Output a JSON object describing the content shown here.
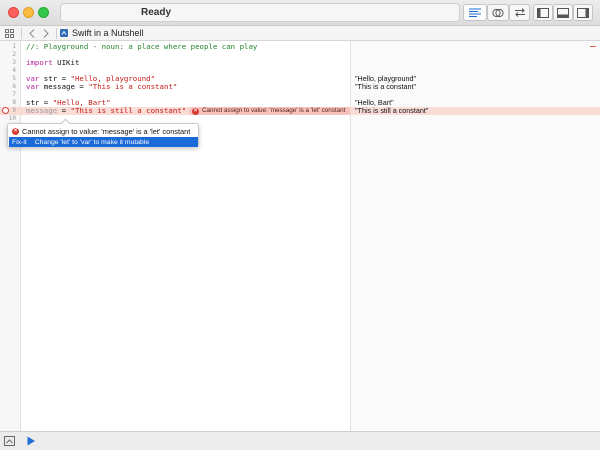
{
  "window": {
    "status": "Ready",
    "colors": {
      "close": "#fc605c",
      "minimize": "#fdbc40",
      "maximize": "#34c84a",
      "accent": "#1a6ad8"
    }
  },
  "toolbar": {
    "icons": [
      "standard-editor-icon",
      "assistant-editor-icon",
      "version-editor-icon",
      "navigator-toggle-icon",
      "debug-area-toggle-icon",
      "utilities-toggle-icon"
    ]
  },
  "jumpbar": {
    "file_name": "Swift in a Nutshell"
  },
  "editor": {
    "lines": [
      {
        "num": "1",
        "parts": [
          {
            "t": "//: Playground - noun: a place where people can play",
            "c": "cmt"
          }
        ]
      },
      {
        "num": "2",
        "parts": []
      },
      {
        "num": "3",
        "parts": [
          {
            "t": "import",
            "c": "kw"
          },
          {
            "t": " UIKit",
            "c": "plain"
          }
        ]
      },
      {
        "num": "4",
        "parts": []
      },
      {
        "num": "5",
        "parts": [
          {
            "t": "var",
            "c": "kw"
          },
          {
            "t": " str = ",
            "c": "plain"
          },
          {
            "t": "\"Hello, playground\"",
            "c": "str"
          }
        ],
        "result": "\"Hello, playground\""
      },
      {
        "num": "6",
        "parts": [
          {
            "t": "var",
            "c": "kw"
          },
          {
            "t": " message = ",
            "c": "plain"
          },
          {
            "t": "\"This is a constant\"",
            "c": "str"
          }
        ],
        "result": "\"This is a constant\""
      },
      {
        "num": "7",
        "parts": []
      },
      {
        "num": "8",
        "parts": [
          {
            "t": "str = ",
            "c": "plain"
          },
          {
            "t": "\"Hello, Bart\"",
            "c": "str"
          }
        ],
        "result": "\"Hello, Bart\""
      },
      {
        "num": "9",
        "parts": [
          {
            "t": "message",
            "c": "faded"
          },
          {
            "t": " = ",
            "c": "plain"
          },
          {
            "t": "\"This is still a constant\"",
            "c": "str"
          }
        ],
        "result": "\"This is still a constant\"",
        "error": true
      },
      {
        "num": "10",
        "parts": []
      }
    ],
    "inline_error": "Cannot assign to value: 'message' is a 'let' constant"
  },
  "fixit": {
    "message": "Cannot assign to value: 'message' is a 'let' constant",
    "tag": "Fix-it",
    "suggestion": "Change 'let' to 'var' to make it mutable"
  }
}
